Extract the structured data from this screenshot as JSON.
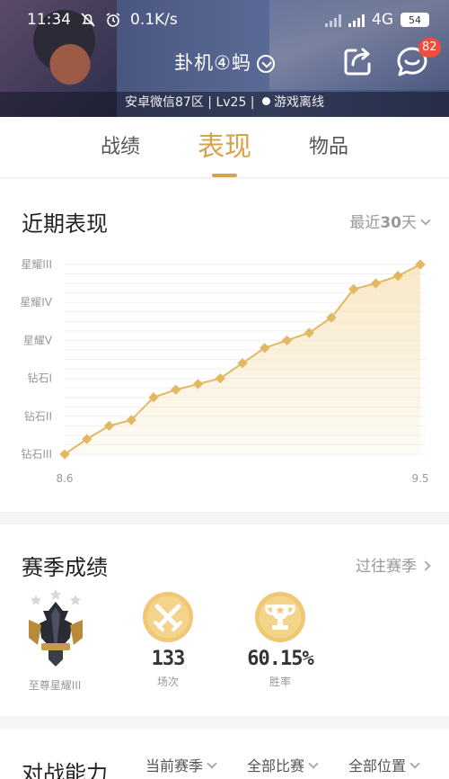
{
  "status_bar": {
    "time": "11:34",
    "net_speed": "0.1K/s",
    "network": "4G",
    "battery": "54"
  },
  "header": {
    "player_name": "卦机④蚂",
    "region": "安卓微信87区",
    "level": "Lv25",
    "game_status": "游戏离线",
    "message_badge": "82"
  },
  "tabs": [
    {
      "label": "战绩",
      "active": false
    },
    {
      "label": "表现",
      "active": true
    },
    {
      "label": "物品",
      "active": false
    }
  ],
  "recent": {
    "title": "近期表现",
    "filter_prefix": "最近",
    "filter_num": "30",
    "filter_suffix": "天"
  },
  "chart_data": {
    "type": "area",
    "x_start_label": "8.6",
    "x_end_label": "9.5",
    "y_tick_labels": [
      "钻石III",
      "钻石II",
      "钻石I",
      "星耀V",
      "星耀IV",
      "星耀III"
    ],
    "values": [
      0.0,
      0.4,
      0.75,
      0.9,
      1.5,
      1.7,
      1.85,
      2.0,
      2.4,
      2.8,
      3.0,
      3.2,
      3.6,
      4.35,
      4.5,
      4.7,
      5.0
    ],
    "ylim": [
      0,
      5
    ],
    "line_color": "#e3b862",
    "fill_color": "#f7e6bf"
  },
  "season": {
    "title": "赛季成绩",
    "link": "过往赛季",
    "rank_label": "至尊星耀III",
    "games_value": "133",
    "games_label": "场次",
    "winrate_value": "60.15%",
    "winrate_label": "胜率"
  },
  "ability": {
    "title": "对战能力",
    "filters": [
      "当前赛季",
      "全部比赛",
      "全部位置"
    ]
  },
  "colors": {
    "accent": "#d8a24a",
    "medal": "#f0c874"
  },
  "icons": {
    "share": "share-icon",
    "message": "message-icon",
    "swords": "crossed-swords-icon",
    "trophy": "trophy-icon"
  }
}
